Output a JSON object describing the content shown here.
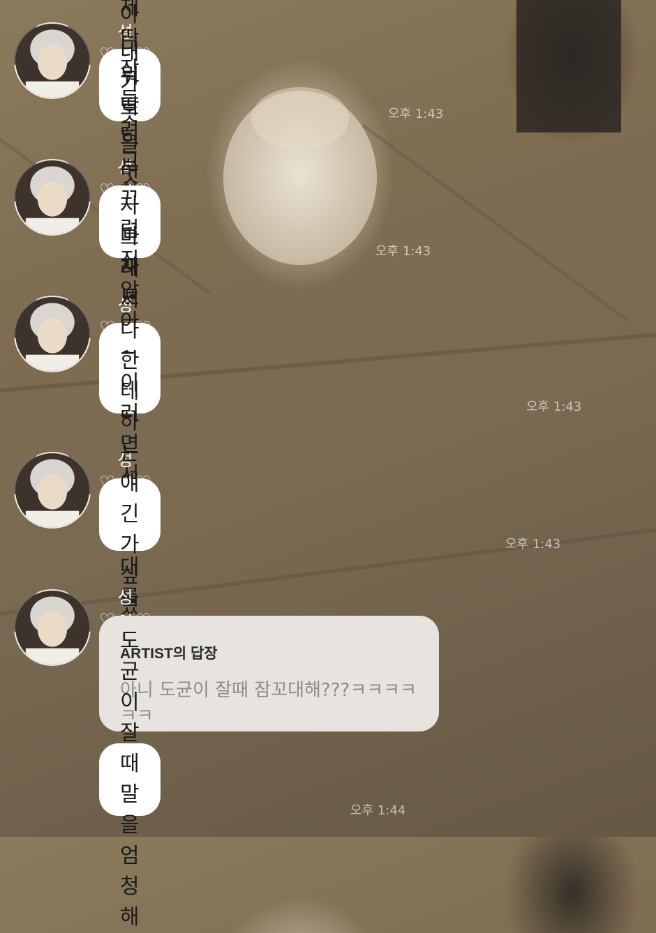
{
  "messages": [
    {
      "sender": "성이리",
      "text": "아니 어제 딱 잠들려고 하는데",
      "time": "오후 1:43"
    },
    {
      "sender": "성이리",
      "text": "내가 옷을 벗자마자 도균이가",
      "time": "오후 1:43"
    },
    {
      "sender": "성이리",
      "text": "아니 뭐 딱히 부끄럽진 않아~ 이러면서\n잠꼬대를 하는 거야",
      "time": "오후 1:43"
    },
    {
      "sender": "성이리",
      "text": "그래서 나한테 하는 얘긴가 싶었엌ㅋㅋㅋㅋㅋ",
      "time": "오후 1:43"
    },
    {
      "sender": "성이리",
      "reply": {
        "title": "ARTIST의 답장",
        "body": "아니 도균이 잘때 잠꼬대해???ㅋㅋㅋㅋㅋㅋ"
      },
      "text": "도균이 잘 때 말을 엄청해",
      "time": "오후 1:44"
    }
  ],
  "icons": {
    "heart": "♡",
    "avatar": "profile-photo"
  },
  "colors": {
    "bubble": "#ffffff",
    "reply_card": "#e7e4df",
    "time": "rgba(255,255,255,0.6)",
    "sender": "#ffffff"
  }
}
